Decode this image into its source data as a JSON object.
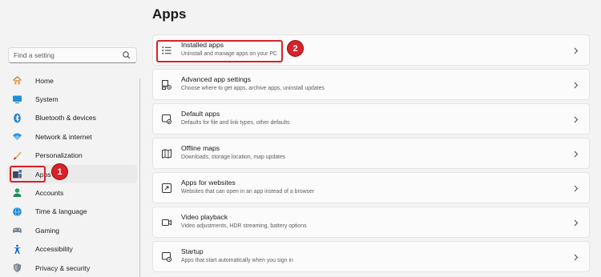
{
  "sidebar": {
    "search": {
      "placeholder": "Find a setting",
      "icon": "search-icon"
    },
    "items": [
      {
        "label": "Home",
        "icon": "home-icon",
        "selected": false
      },
      {
        "label": "System",
        "icon": "system-icon",
        "selected": false
      },
      {
        "label": "Bluetooth & devices",
        "icon": "bluetooth-icon",
        "selected": false
      },
      {
        "label": "Network & internet",
        "icon": "wifi-icon",
        "selected": false
      },
      {
        "label": "Personalization",
        "icon": "brush-icon",
        "selected": false
      },
      {
        "label": "Apps",
        "icon": "apps-icon",
        "selected": true
      },
      {
        "label": "Accounts",
        "icon": "person-icon",
        "selected": false
      },
      {
        "label": "Time & language",
        "icon": "globe-clock-icon",
        "selected": false
      },
      {
        "label": "Gaming",
        "icon": "gamepad-icon",
        "selected": false
      },
      {
        "label": "Accessibility",
        "icon": "accessibility-icon",
        "selected": false
      },
      {
        "label": "Privacy & security",
        "icon": "shield-icon",
        "selected": false
      }
    ]
  },
  "main": {
    "title": "Apps",
    "cards": [
      {
        "title": "Installed apps",
        "desc": "Uninstall and manage apps on your PC",
        "icon": "list-icon"
      },
      {
        "title": "Advanced app settings",
        "desc": "Choose where to get apps, archive apps, uninstall updates",
        "icon": "app-settings-icon"
      },
      {
        "title": "Default apps",
        "desc": "Defaults for file and link types, other defaults",
        "icon": "default-apps-icon"
      },
      {
        "title": "Offline maps",
        "desc": "Downloads, storage location, map updates",
        "icon": "map-icon"
      },
      {
        "title": "Apps for websites",
        "desc": "Websites that can open in an app instead of a browser",
        "icon": "link-app-icon"
      },
      {
        "title": "Video playback",
        "desc": "Video adjustments, HDR streaming, battery options",
        "icon": "video-icon"
      },
      {
        "title": "Startup",
        "desc": "Apps that start automatically when you sign in",
        "icon": "startup-icon"
      }
    ]
  },
  "annotations": {
    "badge1": "1",
    "badge2": "2"
  },
  "colors": {
    "accent": "#0067c0",
    "highlight": "#d8222a"
  }
}
